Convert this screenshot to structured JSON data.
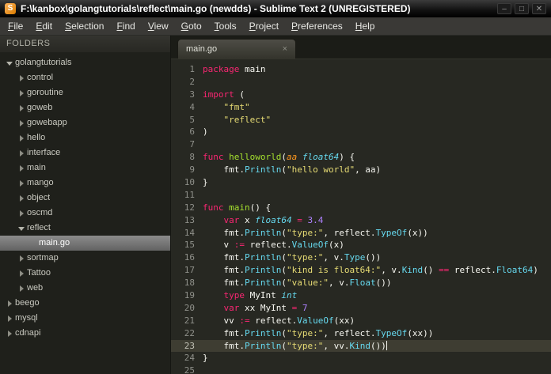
{
  "window": {
    "title": "F:\\kanbox\\golangtutorials\\reflect\\main.go (newdds) - Sublime Text 2 (UNREGISTERED)",
    "app_icon_letter": "S",
    "controls": {
      "minimize": "–",
      "maximize": "□",
      "close": "✕"
    }
  },
  "menu": {
    "items": [
      "File",
      "Edit",
      "Selection",
      "Find",
      "View",
      "Goto",
      "Tools",
      "Project",
      "Preferences",
      "Help"
    ]
  },
  "sidebar": {
    "header": "FOLDERS",
    "tree": [
      {
        "label": "golangtutorials",
        "depth": 0,
        "kind": "folder",
        "arrow": "down"
      },
      {
        "label": "control",
        "depth": 1,
        "kind": "folder",
        "arrow": "right"
      },
      {
        "label": "goroutine",
        "depth": 1,
        "kind": "folder",
        "arrow": "right"
      },
      {
        "label": "goweb",
        "depth": 1,
        "kind": "folder",
        "arrow": "right"
      },
      {
        "label": "gowebapp",
        "depth": 1,
        "kind": "folder",
        "arrow": "right"
      },
      {
        "label": "hello",
        "depth": 1,
        "kind": "folder",
        "arrow": "right"
      },
      {
        "label": "interface",
        "depth": 1,
        "kind": "folder",
        "arrow": "right"
      },
      {
        "label": "main",
        "depth": 1,
        "kind": "folder",
        "arrow": "right"
      },
      {
        "label": "mango",
        "depth": 1,
        "kind": "folder",
        "arrow": "right"
      },
      {
        "label": "object",
        "depth": 1,
        "kind": "folder",
        "arrow": "right"
      },
      {
        "label": "oscmd",
        "depth": 1,
        "kind": "folder",
        "arrow": "right"
      },
      {
        "label": "reflect",
        "depth": 1,
        "kind": "folder",
        "arrow": "down"
      },
      {
        "label": "main.go",
        "depth": 2,
        "kind": "file",
        "selected": true
      },
      {
        "label": "sortmap",
        "depth": 1,
        "kind": "folder",
        "arrow": "right"
      },
      {
        "label": "Tattoo",
        "depth": 1,
        "kind": "folder",
        "arrow": "right"
      },
      {
        "label": "web",
        "depth": 1,
        "kind": "folder",
        "arrow": "right"
      },
      {
        "label": "beego",
        "depth": 0,
        "kind": "folder",
        "arrow": "right"
      },
      {
        "label": "mysql",
        "depth": 0,
        "kind": "folder",
        "arrow": "right"
      },
      {
        "label": "cdnapi",
        "depth": 0,
        "kind": "folder",
        "arrow": "right"
      }
    ]
  },
  "tabs": [
    {
      "label": "main.go",
      "close_glyph": "×",
      "active": true
    }
  ],
  "colors": {
    "editor_bg": "#272822",
    "sidebar_bg": "#1f201b",
    "active_line": "#3e3d32",
    "keyword": "#f92672",
    "string": "#e6db74",
    "number": "#ae81ff",
    "type": "#66d9ef",
    "function_name": "#a6e22e",
    "function_call": "#66d9ef",
    "parameter": "#fd971f",
    "plain_text": "#f8f8f2",
    "line_number": "#8f908a"
  },
  "editor": {
    "lines": [
      {
        "n": 1,
        "tokens": [
          [
            "package",
            "kw"
          ],
          [
            " main",
            "pl"
          ]
        ]
      },
      {
        "n": 2,
        "tokens": []
      },
      {
        "n": 3,
        "tokens": [
          [
            "import",
            "kw"
          ],
          [
            " (",
            "pl"
          ]
        ]
      },
      {
        "n": 4,
        "tokens": [
          [
            "    ",
            "pl"
          ],
          [
            "\"fmt\"",
            "st"
          ]
        ]
      },
      {
        "n": 5,
        "tokens": [
          [
            "    ",
            "pl"
          ],
          [
            "\"reflect\"",
            "st"
          ]
        ]
      },
      {
        "n": 6,
        "tokens": [
          [
            ")",
            "pl"
          ]
        ]
      },
      {
        "n": 7,
        "tokens": []
      },
      {
        "n": 8,
        "tokens": [
          [
            "func",
            "kw"
          ],
          [
            " ",
            "pl"
          ],
          [
            "helloworld",
            "fn"
          ],
          [
            "(",
            "pl"
          ],
          [
            "aa",
            "pr"
          ],
          [
            " ",
            "pl"
          ],
          [
            "float64",
            "ty"
          ],
          [
            ") {",
            "pl"
          ]
        ]
      },
      {
        "n": 9,
        "tokens": [
          [
            "    fmt.",
            "pl"
          ],
          [
            "Println",
            "ca"
          ],
          [
            "(",
            "pl"
          ],
          [
            "\"hello world\"",
            "st"
          ],
          [
            ", aa)",
            "pl"
          ]
        ]
      },
      {
        "n": 10,
        "tokens": [
          [
            "}",
            "pl"
          ]
        ]
      },
      {
        "n": 11,
        "tokens": []
      },
      {
        "n": 12,
        "tokens": [
          [
            "func",
            "kw"
          ],
          [
            " ",
            "pl"
          ],
          [
            "main",
            "fn"
          ],
          [
            "() {",
            "pl"
          ]
        ]
      },
      {
        "n": 13,
        "tokens": [
          [
            "    ",
            "pl"
          ],
          [
            "var",
            "kw"
          ],
          [
            " x ",
            "pl"
          ],
          [
            "float64",
            "ty"
          ],
          [
            " ",
            "pl"
          ],
          [
            "=",
            "op"
          ],
          [
            " ",
            "pl"
          ],
          [
            "3.4",
            "nu"
          ]
        ]
      },
      {
        "n": 14,
        "tokens": [
          [
            "    fmt.",
            "pl"
          ],
          [
            "Println",
            "ca"
          ],
          [
            "(",
            "pl"
          ],
          [
            "\"type:\"",
            "st"
          ],
          [
            ", reflect.",
            "pl"
          ],
          [
            "TypeOf",
            "ca"
          ],
          [
            "(x))",
            "pl"
          ]
        ]
      },
      {
        "n": 15,
        "tokens": [
          [
            "    v ",
            "pl"
          ],
          [
            ":=",
            "op"
          ],
          [
            " reflect.",
            "pl"
          ],
          [
            "ValueOf",
            "ca"
          ],
          [
            "(x)",
            "pl"
          ]
        ]
      },
      {
        "n": 16,
        "tokens": [
          [
            "    fmt.",
            "pl"
          ],
          [
            "Println",
            "ca"
          ],
          [
            "(",
            "pl"
          ],
          [
            "\"type:\"",
            "st"
          ],
          [
            ", v.",
            "pl"
          ],
          [
            "Type",
            "ca"
          ],
          [
            "())",
            "pl"
          ]
        ]
      },
      {
        "n": 17,
        "tokens": [
          [
            "    fmt.",
            "pl"
          ],
          [
            "Println",
            "ca"
          ],
          [
            "(",
            "pl"
          ],
          [
            "\"kind is float64:\"",
            "st"
          ],
          [
            ", v.",
            "pl"
          ],
          [
            "Kind",
            "ca"
          ],
          [
            "() ",
            "pl"
          ],
          [
            "==",
            "op"
          ],
          [
            " reflect.",
            "pl"
          ],
          [
            "Float64",
            "ca"
          ],
          [
            ")",
            "pl"
          ]
        ]
      },
      {
        "n": 18,
        "tokens": [
          [
            "    fmt.",
            "pl"
          ],
          [
            "Println",
            "ca"
          ],
          [
            "(",
            "pl"
          ],
          [
            "\"value:\"",
            "st"
          ],
          [
            ", v.",
            "pl"
          ],
          [
            "Float",
            "ca"
          ],
          [
            "())",
            "pl"
          ]
        ]
      },
      {
        "n": 19,
        "tokens": [
          [
            "    ",
            "pl"
          ],
          [
            "type",
            "kw"
          ],
          [
            " MyInt ",
            "pl"
          ],
          [
            "int",
            "ty"
          ]
        ]
      },
      {
        "n": 20,
        "tokens": [
          [
            "    ",
            "pl"
          ],
          [
            "var",
            "kw"
          ],
          [
            " xx MyInt ",
            "pl"
          ],
          [
            "=",
            "op"
          ],
          [
            " ",
            "pl"
          ],
          [
            "7",
            "nu"
          ]
        ]
      },
      {
        "n": 21,
        "tokens": [
          [
            "    vv ",
            "pl"
          ],
          [
            ":=",
            "op"
          ],
          [
            " reflect.",
            "pl"
          ],
          [
            "ValueOf",
            "ca"
          ],
          [
            "(xx)",
            "pl"
          ]
        ]
      },
      {
        "n": 22,
        "tokens": [
          [
            "    fmt.",
            "pl"
          ],
          [
            "Println",
            "ca"
          ],
          [
            "(",
            "pl"
          ],
          [
            "\"type:\"",
            "st"
          ],
          [
            ", reflect.",
            "pl"
          ],
          [
            "TypeOf",
            "ca"
          ],
          [
            "(xx))",
            "pl"
          ]
        ]
      },
      {
        "n": 23,
        "tokens": [
          [
            "    fmt.",
            "pl"
          ],
          [
            "Println",
            "ca"
          ],
          [
            "(",
            "pl"
          ],
          [
            "\"type:\"",
            "st"
          ],
          [
            ", vv.",
            "pl"
          ],
          [
            "Kind",
            "ca"
          ],
          [
            "())",
            "pl"
          ]
        ],
        "active": true,
        "cursor": true
      },
      {
        "n": 24,
        "tokens": [
          [
            "}",
            "pl"
          ]
        ]
      },
      {
        "n": 25,
        "tokens": []
      }
    ]
  }
}
